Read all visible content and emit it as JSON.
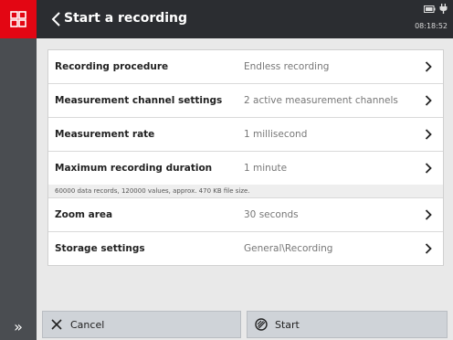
{
  "header": {
    "title": "Start a recording",
    "time": "08:18:52"
  },
  "settings": [
    {
      "label": "Recording procedure",
      "value": "Endless recording"
    },
    {
      "label": "Measurement channel settings",
      "value": "2 active measurement channels"
    },
    {
      "label": "Measurement rate",
      "value": "1 millisecond"
    },
    {
      "label": "Maximum recording duration",
      "value": "1 minute",
      "note": "60000 data records, 120000 values, approx. 470 KB file size."
    },
    {
      "label": "Zoom area",
      "value": "30 seconds"
    },
    {
      "label": "Storage settings",
      "value": "General\\Recording"
    }
  ],
  "footer": {
    "cancel_label": "Cancel",
    "start_label": "Start",
    "expand_glyph": "»"
  },
  "colors": {
    "accent": "#e30613",
    "header_bg": "#2b2d31",
    "sidebar_bg": "#4a4d51",
    "button_bg": "#cfd3d8"
  }
}
